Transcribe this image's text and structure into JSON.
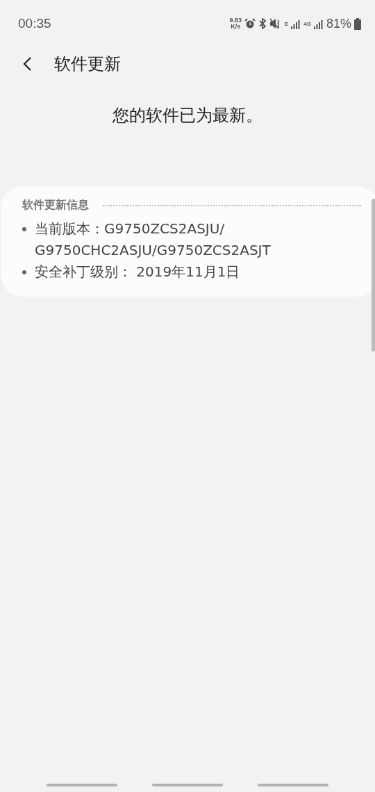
{
  "status_bar": {
    "time": "00:35",
    "net_speed": [
      "9.83",
      "K/s"
    ],
    "network_e": "E",
    "network_4g": "4G",
    "battery": "81%"
  },
  "header": {
    "title": "软件更新"
  },
  "message": "您的软件已为最新。",
  "info_card": {
    "title": "软件更新信息",
    "items": [
      {
        "label": "当前版本：",
        "value": "G9750ZCS2ASJU/ G9750CHC2ASJU/G9750ZCS2ASJT"
      },
      {
        "label": "安全补丁级别：",
        "value": " 2019年11月1日"
      }
    ]
  }
}
